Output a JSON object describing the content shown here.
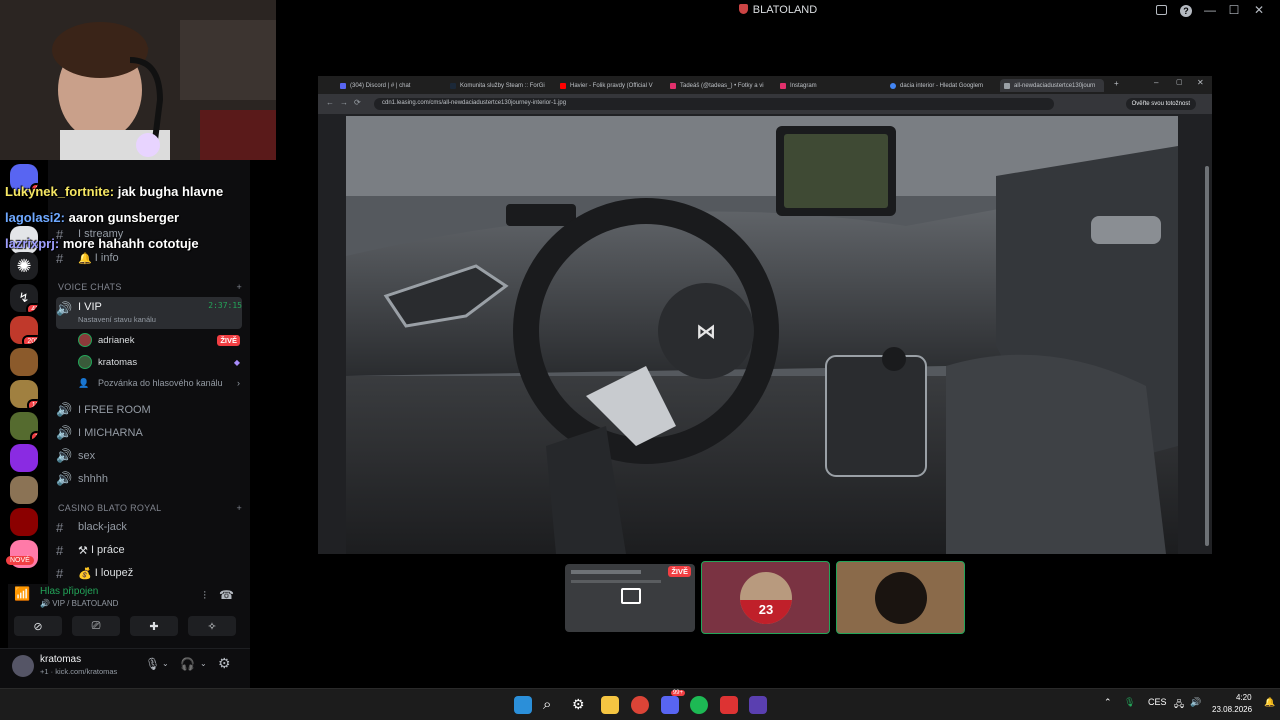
{
  "window": {
    "title": "BLATOLAND"
  },
  "chat_overlay": [
    {
      "user": "Lukynek_fortnite:",
      "text": "jak bugha hlavne",
      "color": "#f5e663"
    },
    {
      "user": "lagolasi2:",
      "text": "aaron gunsberger",
      "color": "#6ea8ff"
    },
    {
      "user": "lazrixprj:",
      "text": "more hahahh cototuje",
      "color": "#a0a0ff"
    }
  ],
  "servers": [
    {
      "badge": "1",
      "color": "#5865f2"
    },
    {
      "badge": "",
      "color": "#e3e5e8"
    },
    {
      "badge": "",
      "color": "#1e1f22"
    },
    {
      "badge": "43",
      "color": "#2b2d31"
    },
    {
      "badge": "205",
      "color": "#c0392b"
    },
    {
      "badge": "",
      "color": "#8b5a2b"
    },
    {
      "badge": "11",
      "color": "#a08040"
    },
    {
      "badge": "7",
      "color": "#556b2f"
    },
    {
      "badge": "",
      "color": "#8a2be2"
    },
    {
      "badge": "",
      "color": "#8b7355"
    },
    {
      "badge": "",
      "color": "#8b0000"
    },
    {
      "badge": "NOVÉ",
      "color": "#ff7aa8"
    }
  ],
  "channels": {
    "text_top": [
      {
        "label": "I streamy",
        "icon": "📺"
      },
      {
        "label": "I info",
        "icon": "🔔"
      }
    ],
    "voice_category": "VOICE CHATS",
    "voice": [
      {
        "label": "I VIP",
        "timer": "2:37:15",
        "status": "Nastavení stavu kanálu"
      },
      {
        "label": "I FREE ROOM"
      },
      {
        "label": "I MICHARNA"
      },
      {
        "label": "sex"
      },
      {
        "label": "shhhh"
      }
    ],
    "vip_users": [
      {
        "name": "adrianek",
        "badge": "ŽIVĚ"
      },
      {
        "name": "kratomas",
        "badge": ""
      }
    ],
    "invite": "Pozvánka do hlasového kanálu",
    "casino_category": "CASINO BLATO ROYAL",
    "casino": [
      {
        "label": "black-jack"
      },
      {
        "label": "I práce",
        "icon": "⚒"
      },
      {
        "label": "I loupež",
        "icon": "💰"
      }
    ]
  },
  "voice_panel": {
    "status": "Hlas připojen",
    "location": "VIP / BLATOLAND"
  },
  "user_panel": {
    "name": "kratomas",
    "subtext": "+1 · kick.com/kratomas"
  },
  "browser": {
    "tabs": [
      "(304) Discord | # | chat",
      "Komunita služby Steam :: ForGi",
      "Havier - Folik pravdy (Official V",
      "Tadeáš (@tadeas_) • Fotky a vi",
      "Instagram",
      "dacia interior - Hledat Googlem",
      "all-newdaciadustertce130journ"
    ],
    "url": "cdn1.leasing.com/cms/all-newdaciadustertce130journey-interior-1.jpg",
    "verify_label": "Ověřte svou totožnost"
  },
  "stream_tiles": [
    {
      "kind": "screen",
      "badge": "ŽIVĚ"
    },
    {
      "kind": "avatar",
      "label": "23"
    },
    {
      "kind": "avatar",
      "label": ""
    }
  ],
  "taskbar": {
    "lang": "CES",
    "time": "4:20",
    "date": "23.08.2026",
    "discord_badge": "99+"
  }
}
